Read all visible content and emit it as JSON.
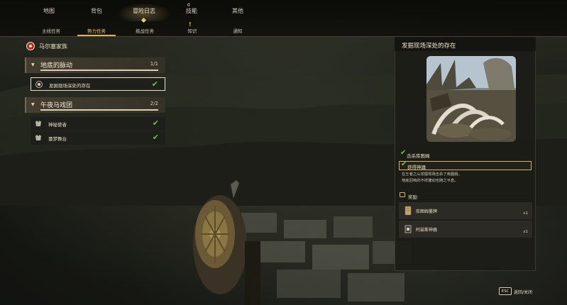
{
  "nav": {
    "main": [
      {
        "label": "地图"
      },
      {
        "label": "背包"
      },
      {
        "label": "冒险日志"
      },
      {
        "label": "技能"
      },
      {
        "label": "其他"
      }
    ],
    "skills_badge": "0",
    "sub": [
      {
        "label": "主线任务"
      },
      {
        "label": "势力任务"
      },
      {
        "label": "挑战任务"
      },
      {
        "label": "知识"
      },
      {
        "label": "通知"
      }
    ],
    "knowledge_alert": "!"
  },
  "faction": {
    "title": "马尔塞家族",
    "icon": "faction-emblem-icon"
  },
  "groups": [
    {
      "name": "地底的脉动",
      "count": "1/1",
      "quests": [
        {
          "name": "发掘现场深处的存在",
          "completed": true,
          "icon": "quest-complete-icon"
        }
      ]
    },
    {
      "name": "午夜马戏团",
      "count": "2/2",
      "quests": [
        {
          "name": "神秘使者",
          "completed": true,
          "icon": "quest-emblem-icon"
        },
        {
          "name": "噩梦舞台",
          "completed": true,
          "icon": "quest-emblem-icon"
        }
      ]
    }
  ],
  "detail": {
    "title": "发掘现场深处的存在",
    "objectives": [
      {
        "text": "击杀库图姆",
        "completed": true
      },
      {
        "text": "获得神器",
        "completed": true
      }
    ],
    "description": "在王者之山发掘现场击杀了库图姆。\n地底回响的不祥撞动也随之平息。",
    "rewards_label": "奖励",
    "rewards": [
      {
        "name": "库图姆墨牌",
        "qty": "x1",
        "icon": "tablet-icon"
      },
      {
        "name": "阿兹斯神器",
        "qty": "x1",
        "icon": "artifact-icon"
      }
    ]
  },
  "footer": {
    "esc_key": "ESC",
    "esc_label": "返回/关闭"
  },
  "colors": {
    "accent_gold": "#d6b464",
    "check_green": "#6cc24a",
    "faction_red": "#b52a24"
  }
}
